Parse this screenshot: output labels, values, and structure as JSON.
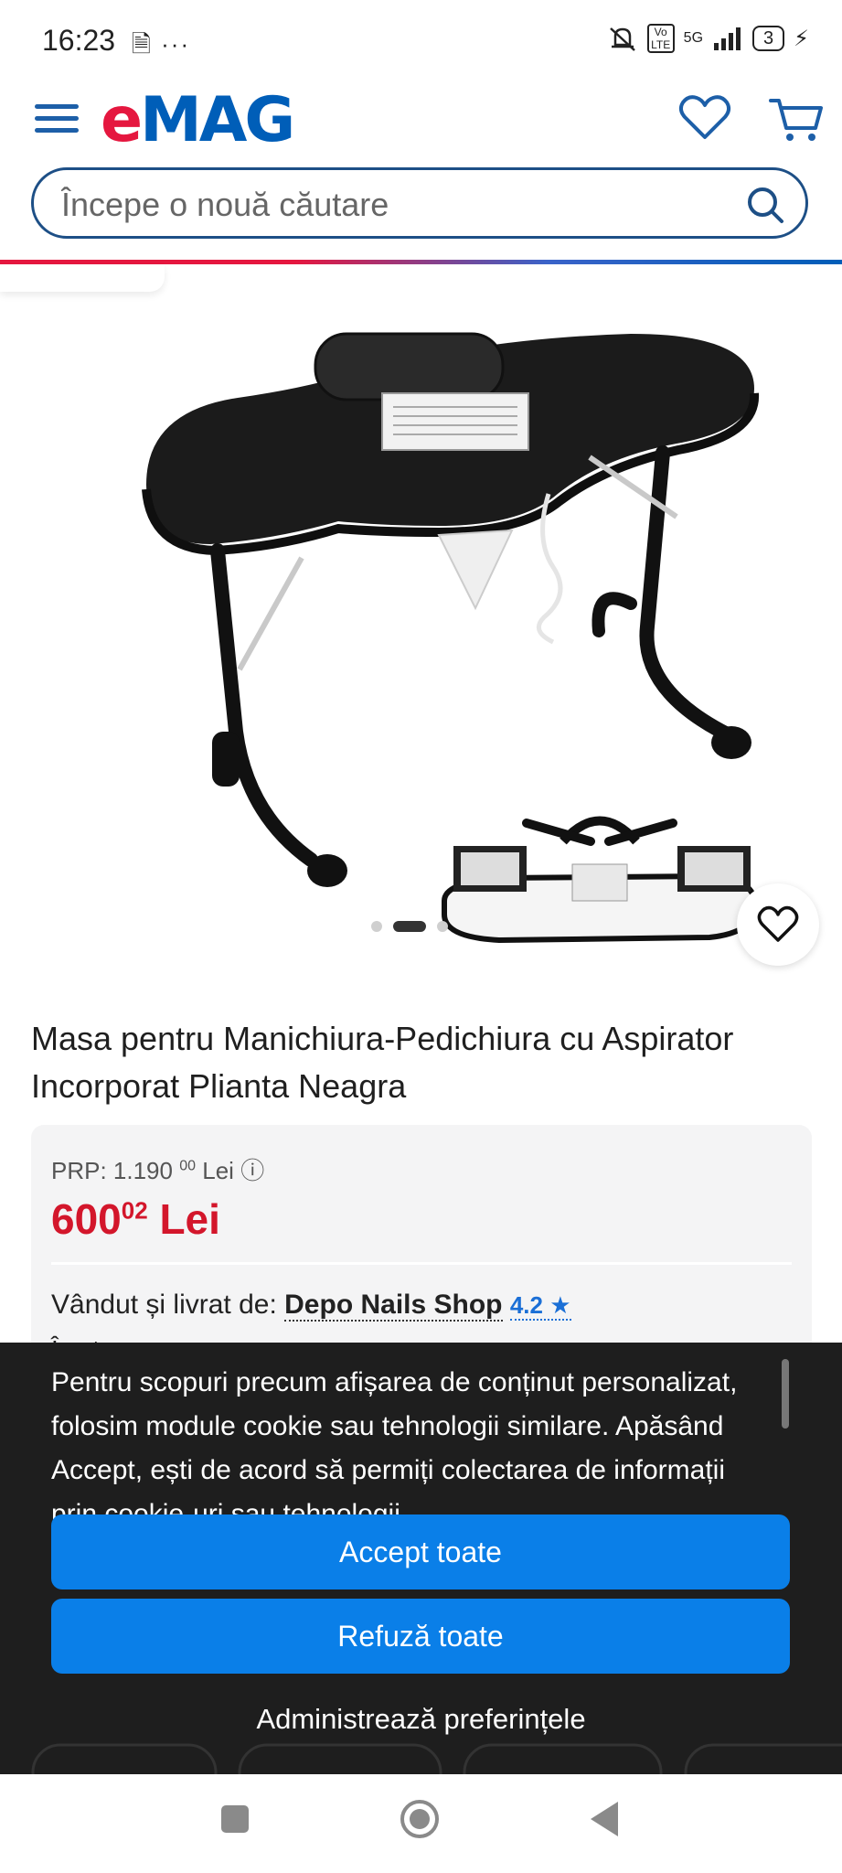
{
  "status_bar": {
    "time": "16:23",
    "left_icons": "🗎 ···",
    "network": "5G",
    "volte": "Vo LTE",
    "battery": "3"
  },
  "header": {
    "logo_e": "e",
    "logo_rest": "MAG"
  },
  "search": {
    "placeholder": "Începe o nouă căutare"
  },
  "product": {
    "title": "Masa pentru Manichiura-Pedichiura cu Aspirator Incorporat Plianta Neagra",
    "carousel_dots": 3,
    "carousel_active": 2
  },
  "price_card": {
    "prp_label": "PRP: 1.190",
    "prp_decimals": "00",
    "prp_currency": "Lei",
    "info_icon": "ⓘ",
    "price_int": "600",
    "price_decimals": "02",
    "price_currency": "Lei",
    "sold_by_label": "Vândut și livrat de:",
    "seller_name": "Depo Nails Shop",
    "seller_rating": "4.2 ★",
    "stock": "În stoc"
  },
  "cookie": {
    "text": "Pentru scopuri precum afișarea de conținut personalizat, folosim module cookie sau tehnologii similare. Apăsând Accept, ești de acord să permiți colectarea de informații prin cookie-uri sau tehnologii",
    "accept_label": "Accept toate",
    "refuse_label": "Refuză toate",
    "manage_label": "Administrează preferințele"
  },
  "colors": {
    "brand_red": "#e5173f",
    "brand_blue": "#005eb8",
    "price_red": "#d3162b",
    "button_blue": "#0a7fe8",
    "overlay": "#1e1e1e"
  }
}
